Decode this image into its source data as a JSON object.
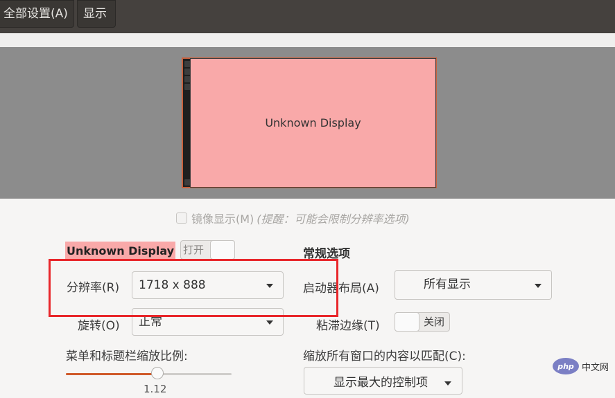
{
  "header": {
    "all_settings_label": "全部设置(A)",
    "title": "显示"
  },
  "arrangement": {
    "display_label": "Unknown Display",
    "display_color": "#f9a9a9"
  },
  "mirror": {
    "label": "镜像显示(M)",
    "hint": "(提醒：可能会限制分辨率选项)",
    "checked": false
  },
  "display": {
    "name": "Unknown Display",
    "toggle_label": "打开",
    "toggle_state": "on"
  },
  "resolution": {
    "label": "分辨率(R)",
    "value": "1718 x 888"
  },
  "rotation": {
    "label": "旋转(O)",
    "value": "正常"
  },
  "scale": {
    "label": "菜单和标题栏缩放比例:",
    "value_text": "1.12",
    "fraction": 0.55
  },
  "general": {
    "title": "常规选项",
    "launcher_label": "启动器布局(A)",
    "launcher_value": "所有显示",
    "sticky_label": "粘滞边缘(T)",
    "sticky_toggle": "关闭",
    "fit_label": "缩放所有窗口的内容以匹配(C):",
    "fit_value": "显示最大的控制项"
  },
  "watermark": {
    "logo": "php",
    "text": "中文网"
  },
  "colors": {
    "accent": "#d05a2a",
    "annotation": "#e8262a"
  }
}
